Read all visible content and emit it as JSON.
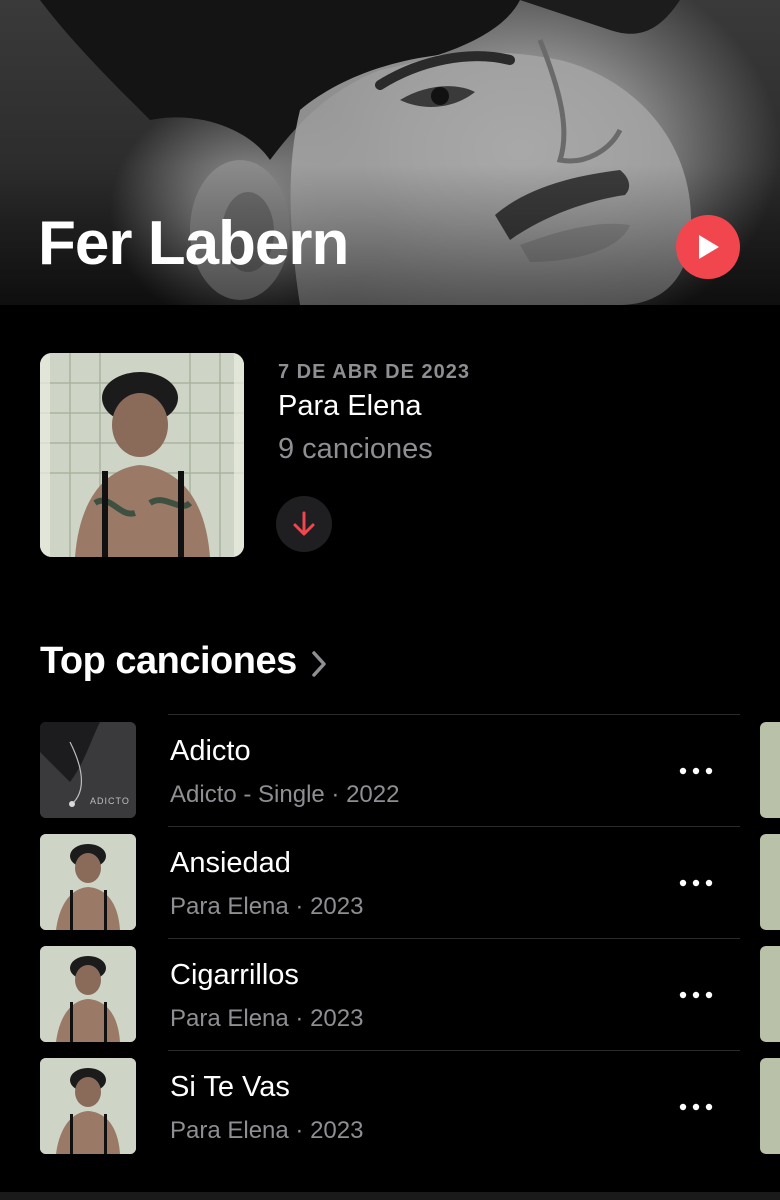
{
  "hero": {
    "artist_name": "Fer Labern",
    "play_icon": "play-icon"
  },
  "latest_release": {
    "date": "7 DE ABR DE 2023",
    "title": "Para Elena",
    "count": "9 canciones",
    "download_icon": "arrow-down-icon"
  },
  "top_songs": {
    "title": "Top canciones",
    "chevron_icon": "chevron-right-icon",
    "items": [
      {
        "title": "Adicto",
        "subtitle": "Adicto - Single · 2022",
        "art_text": "ADICTO"
      },
      {
        "title": "Ansiedad",
        "subtitle": "Para Elena · 2023"
      },
      {
        "title": "Cigarrillos",
        "subtitle": "Para Elena · 2023"
      },
      {
        "title": "Si Te Vas",
        "subtitle": "Para Elena · 2023"
      }
    ],
    "more_icon": "ellipsis-icon"
  },
  "colors": {
    "accent": "#f2464f",
    "background": "#000000",
    "secondary_text": "#8e8e93"
  }
}
